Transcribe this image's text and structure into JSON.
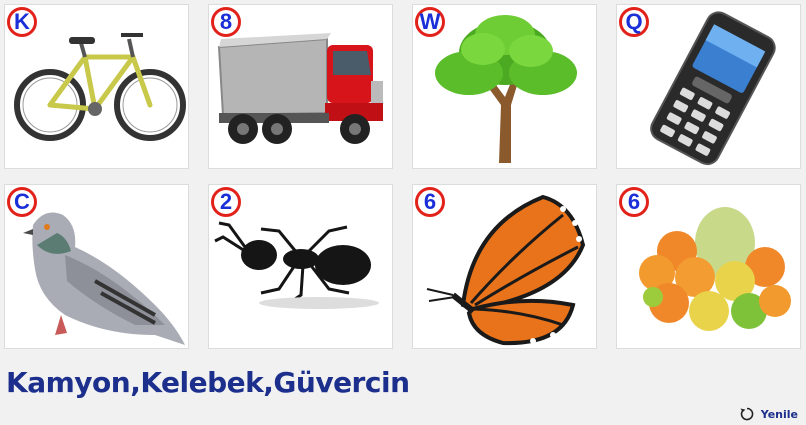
{
  "tiles": [
    {
      "code": "K",
      "icon": "bicycle-icon"
    },
    {
      "code": "8",
      "icon": "truck-icon"
    },
    {
      "code": "W",
      "icon": "tree-icon"
    },
    {
      "code": "Q",
      "icon": "mobile-phone-icon"
    },
    {
      "code": "C",
      "icon": "pigeon-icon"
    },
    {
      "code": "2",
      "icon": "ant-icon"
    },
    {
      "code": "6",
      "icon": "butterfly-icon"
    },
    {
      "code": "6",
      "icon": "fruits-icon"
    }
  ],
  "answer_text": "Kamyon,Kelebek,Güvercin",
  "refresh_label": "Yenile",
  "colors": {
    "badge_ring": "#e2221a",
    "badge_text": "#1a2fd8",
    "answer_text": "#1c2f8c"
  }
}
